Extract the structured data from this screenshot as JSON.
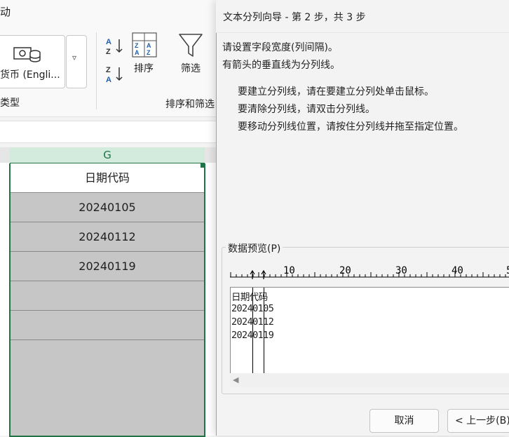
{
  "ribbon": {
    "tab_partial": "动",
    "currency_label": "货币 (Engli...",
    "dropdown_arrow": "▿",
    "group_number_type": "类型",
    "sort_label": "排序",
    "filter_label": "筛选",
    "group_sort_filter": "排序和筛选"
  },
  "sheet": {
    "column_letter": "G",
    "cells": [
      "日期代码",
      "20240105",
      "20240112",
      "20240119",
      "",
      ""
    ]
  },
  "dialog": {
    "title": "文本分列向导 - 第 2 步，共 3 步",
    "intro_lines": [
      "请设置字段宽度(列间隔)。",
      "有箭头的垂直线为分列线。"
    ],
    "instructions": [
      "要建立分列线，请在要建立分列处单击鼠标。",
      "要清除分列线，请双击分列线。",
      "要移动分列线位置，请按住分列线并拖至指定位置。"
    ],
    "preview_label": "数据预览(P)",
    "ruler_ticks": [
      "10",
      "20",
      "30",
      "40",
      "5"
    ],
    "preview_lines": [
      "日期代码",
      "20240105",
      "20240112",
      "20240119"
    ],
    "cancel_label": "取消",
    "back_label": "< 上一步(B)"
  }
}
